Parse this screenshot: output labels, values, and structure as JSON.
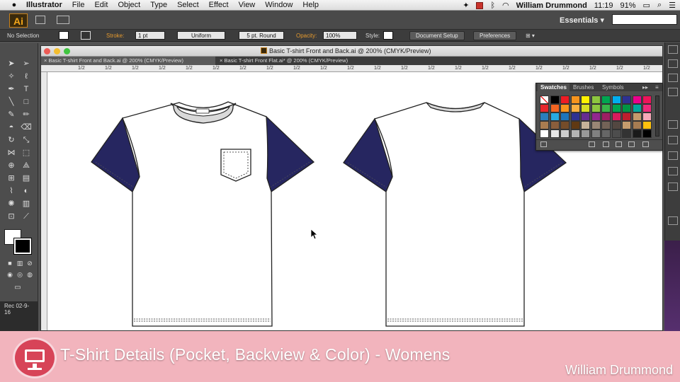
{
  "menubar": {
    "app_name": "Illustrator",
    "items": [
      "File",
      "Edit",
      "Object",
      "Type",
      "Select",
      "Effect",
      "View",
      "Window",
      "Help"
    ],
    "time": "11:19",
    "battery": "91%",
    "user": "William Drummond"
  },
  "appbar": {
    "logo": "Ai",
    "workspace": "Essentials",
    "workspace_chevron": "▾"
  },
  "control": {
    "selection": "No Selection",
    "stroke_label": "Stroke:",
    "stroke_value": "1 pt",
    "profile": "Uniform",
    "brush": "5 pt. Round",
    "opacity_label": "Opacity:",
    "opacity_value": "100%",
    "style_label": "Style:",
    "document_setup": "Document Setup",
    "preferences": "Preferences"
  },
  "toolbar": {
    "rec_label": "Rec 02-9-16"
  },
  "document": {
    "window_title": "Basic T-shirt Front and Back.ai @ 200% (CMYK/Preview)",
    "tabs": [
      {
        "label": "Basic T-shirt Front and Back.ai @ 200% (CMYK/Preview)",
        "close": "×"
      },
      {
        "label": "Basic T-shirt Front Flat.ai* @ 200% (CMYK/Preview)",
        "close": "×"
      }
    ],
    "ruler_marks": [
      "1/2",
      "1/2",
      "1/2",
      "1/2",
      "1/2",
      "1/2",
      "1/2",
      "1/2",
      "1/2",
      "1/2",
      "1/2",
      "1/2",
      "1/2",
      "1/2",
      "1/2",
      "1/2",
      "1/2",
      "1/2",
      "1/2",
      "1/2",
      "1/2",
      "1/2"
    ]
  },
  "swatches_panel": {
    "tabs": [
      "Swatches",
      "Brushes",
      "Symbols"
    ],
    "more": "▸▸",
    "colors": [
      [
        "#ffffff",
        "#000000",
        "#ed1c24",
        "#f7941d",
        "#fff200",
        "#8dc63f",
        "#00a651",
        "#00aeef",
        "#2e3192",
        "#ec008c",
        "#ed145b"
      ],
      [
        "#e8262c",
        "#f26522",
        "#f7941d",
        "#fbb040",
        "#d7df23",
        "#8dc63f",
        "#39b54a",
        "#00a651",
        "#009444",
        "#00a99d",
        "#ee2a7b"
      ],
      [
        "#2b7ebd",
        "#27aae1",
        "#1c75bc",
        "#2e3192",
        "#662d91",
        "#92278f",
        "#9e1f63",
        "#da1c5c",
        "#be1e2d",
        "#c49a6c",
        "#f7a8b8"
      ],
      [
        "#a97c50",
        "#8b5e3c",
        "#754c29",
        "#603913",
        "#c7b299",
        "#998675",
        "#736357",
        "#534741",
        "#c69c6d",
        "#a67c52",
        "#ffc20e"
      ],
      [
        "#ffffff",
        "#e6e6e6",
        "#cccccc",
        "#b3b3b3",
        "#999999",
        "#808080",
        "#666666",
        "#4d4d4d",
        "#333333",
        "#1a1a1a",
        "#000000"
      ]
    ]
  },
  "artwork": {
    "sleeve_color": "#262660",
    "collar_color": "#d9d9d9"
  },
  "banner": {
    "title": "T-Shirt Details (Pocket, Backview & Color) - Womens",
    "author": "William Drummond",
    "bg_color": "#f2b4bd",
    "icon_color": "#d74458"
  }
}
